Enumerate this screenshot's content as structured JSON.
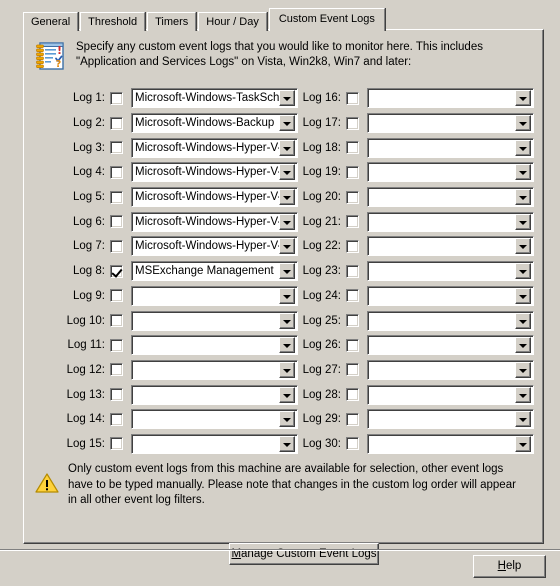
{
  "window": {
    "background_color": "#d4d0c8"
  },
  "tabs": [
    {
      "label": "General",
      "active": false
    },
    {
      "label": "Threshold",
      "active": false
    },
    {
      "label": "Timers",
      "active": false
    },
    {
      "label": "Hour / Day",
      "active": false
    },
    {
      "label": "Custom Event Logs",
      "active": true
    }
  ],
  "header": {
    "icon": "notebook-icon",
    "text": "Specify any custom event logs that you would like to monitor here. This includes \"Application and Services Logs\" on Vista, Win2k8, Win7 and later:"
  },
  "logs_left": [
    {
      "label": "Log 1:",
      "checked": false,
      "value": "Microsoft-Windows-TaskSche"
    },
    {
      "label": "Log 2:",
      "checked": false,
      "value": "Microsoft-Windows-Backup"
    },
    {
      "label": "Log 3:",
      "checked": false,
      "value": "Microsoft-Windows-Hyper-V-"
    },
    {
      "label": "Log 4:",
      "checked": false,
      "value": "Microsoft-Windows-Hyper-V-"
    },
    {
      "label": "Log 5:",
      "checked": false,
      "value": "Microsoft-Windows-Hyper-V-"
    },
    {
      "label": "Log 6:",
      "checked": false,
      "value": "Microsoft-Windows-Hyper-V-"
    },
    {
      "label": "Log 7:",
      "checked": false,
      "value": "Microsoft-Windows-Hyper-V-"
    },
    {
      "label": "Log 8:",
      "checked": true,
      "value": "MSExchange Management"
    },
    {
      "label": "Log 9:",
      "checked": false,
      "value": ""
    },
    {
      "label": "Log 10:",
      "checked": false,
      "value": ""
    },
    {
      "label": "Log 11:",
      "checked": false,
      "value": ""
    },
    {
      "label": "Log 12:",
      "checked": false,
      "value": ""
    },
    {
      "label": "Log 13:",
      "checked": false,
      "value": ""
    },
    {
      "label": "Log 14:",
      "checked": false,
      "value": ""
    },
    {
      "label": "Log 15:",
      "checked": false,
      "value": ""
    }
  ],
  "logs_right": [
    {
      "label": "Log 16:",
      "checked": false,
      "value": ""
    },
    {
      "label": "Log 17:",
      "checked": false,
      "value": ""
    },
    {
      "label": "Log 18:",
      "checked": false,
      "value": ""
    },
    {
      "label": "Log 19:",
      "checked": false,
      "value": ""
    },
    {
      "label": "Log 20:",
      "checked": false,
      "value": ""
    },
    {
      "label": "Log 21:",
      "checked": false,
      "value": ""
    },
    {
      "label": "Log 22:",
      "checked": false,
      "value": ""
    },
    {
      "label": "Log 23:",
      "checked": false,
      "value": ""
    },
    {
      "label": "Log 24:",
      "checked": false,
      "value": ""
    },
    {
      "label": "Log 25:",
      "checked": false,
      "value": ""
    },
    {
      "label": "Log 26:",
      "checked": false,
      "value": ""
    },
    {
      "label": "Log 27:",
      "checked": false,
      "value": ""
    },
    {
      "label": "Log 28:",
      "checked": false,
      "value": ""
    },
    {
      "label": "Log 29:",
      "checked": false,
      "value": ""
    },
    {
      "label": "Log 30:",
      "checked": false,
      "value": ""
    }
  ],
  "warning": {
    "icon": "warning-triangle-icon",
    "text": "Only custom event logs from this machine are available for selection, other event logs have to be typed manually. Please note that changes in the custom log order will appear in all other event log filters."
  },
  "buttons": {
    "manage": {
      "accel": "M",
      "rest": "anage Custom Event Logs"
    },
    "help": {
      "accel": "H",
      "rest": "elp"
    }
  }
}
